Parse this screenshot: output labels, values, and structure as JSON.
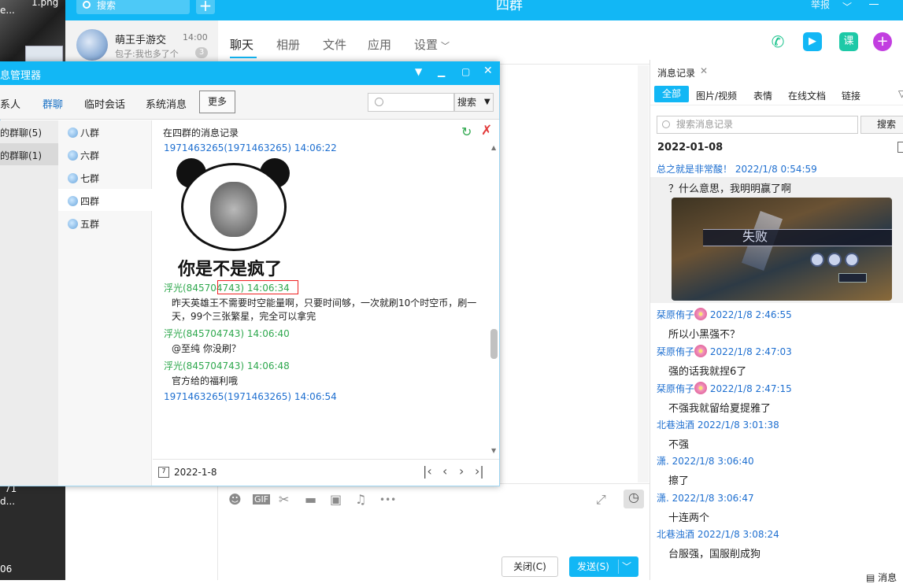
{
  "desktop": {
    "labels": [
      "1.png",
      "e...",
      "71",
      "d...",
      "06"
    ]
  },
  "topbar": {
    "search_placeholder": "搜索",
    "add": "+",
    "title": "四群",
    "report": "举报"
  },
  "contact": {
    "name": "萌王手游交",
    "time": "14:00",
    "message": "包子:我也多了个",
    "unread": "3"
  },
  "tabs": [
    "聊天",
    "相册",
    "文件",
    "应用",
    "设置"
  ],
  "toolbar_icons": [
    "emoji-icon",
    "gif-icon",
    "scissors-icon",
    "folder-icon",
    "image-icon",
    "bell-off-icon",
    "more-icon"
  ],
  "toolbar_glyphs": {
    "emoji": "☻",
    "gif": "GIF",
    "scissors": "✂",
    "folder": "▬",
    "image": "▣",
    "bell": "♫",
    "more": "•••",
    "expand": "⤢",
    "clock": "◷"
  },
  "buttons": {
    "close": "关闭(C)",
    "send": "发送(S)"
  },
  "history": {
    "title": "消息记录",
    "tabs": [
      "全部",
      "图片/视频",
      "表情",
      "在线文档",
      "链接"
    ],
    "search_placeholder": "搜索消息记录",
    "search_btn": "搜索",
    "date": "2022-01-08",
    "messages": [
      {
        "head": "总之就是非常酸！ 2022/1/8 0:54:59",
        "body": "？什么意思，我明明赢了啊"
      },
      {
        "head": "栞原侑子",
        "time": "2022/1/8 2:46:55",
        "body": "所以小黑强不？"
      },
      {
        "head": "栞原侑子",
        "time": "2022/1/8 2:47:03",
        "body": "强的话我就捏6了"
      },
      {
        "head": "栞原侑子",
        "time": "2022/1/8 2:47:15",
        "body": "不强我就留给夏提雅了"
      },
      {
        "head": "北巷浊酒 2022/1/8 3:01:38",
        "body": "不强"
      },
      {
        "head": "潇. 2022/1/8 3:06:40",
        "body": "擦了"
      },
      {
        "head": "潇. 2022/1/8 3:06:47",
        "body": "十连两个"
      },
      {
        "head": "北巷浊酒 2022/1/8 3:08:24",
        "body": "台服强，国服削成狗"
      }
    ],
    "image_text": "失败",
    "bottom": "消息"
  },
  "dialog": {
    "title": "息管理器",
    "nav": [
      "系人",
      "群聊",
      "临时会话",
      "系统消息",
      "更多"
    ],
    "search_btn": "搜索",
    "col1": [
      "的群聊(5)",
      "的群聊(1)"
    ],
    "groups": [
      "八群",
      "六群",
      "七群",
      "四群",
      "五群"
    ],
    "content_head": "在四群的消息记录",
    "records": [
      {
        "head": "1971463265(1971463265) 14:06:22",
        "color": "blue"
      },
      {
        "head": "浮光(845704743) 14:06:34",
        "color": "green",
        "body": "昨天英雄王不需要时空能量啊，只要时间够，一次就刷10个时空币，刷一天，99个三张繁星，完全可以拿完"
      },
      {
        "head": "浮光(845704743) 14:06:40",
        "color": "green",
        "body": "@至纯 你没刷？"
      },
      {
        "head": "浮光(845704743) 14:06:48",
        "color": "green",
        "body": "官方给的福利哦"
      },
      {
        "head": "1971463265(1971463265) 14:06:54",
        "color": "blue"
      }
    ],
    "meme_caption": "你是不是疯了",
    "date": "2022-1-8",
    "cal_day": "7"
  }
}
